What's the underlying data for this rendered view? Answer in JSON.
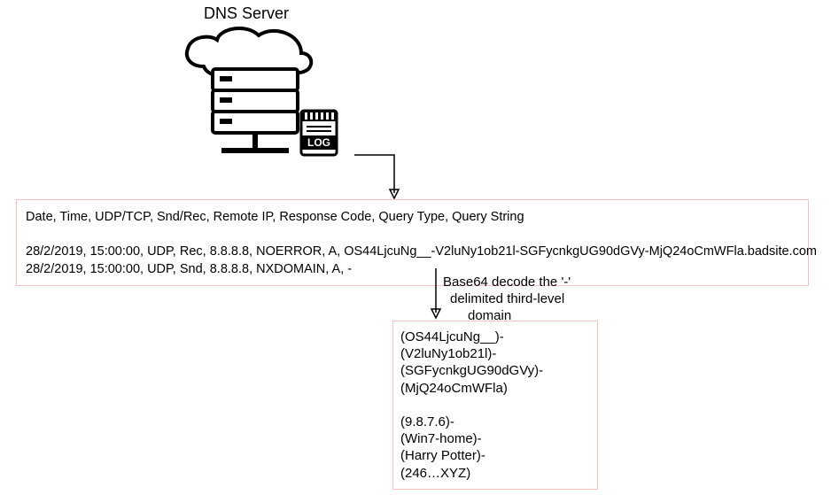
{
  "title": "DNS Server",
  "log": {
    "headers": "Date, Time, UDP/TCP, Snd/Rec, Remote IP, Response Code, Query Type, Query String",
    "rows": [
      "28/2/2019, 15:00:00, UDP, Rec, 8.8.8.8, NOERROR, A, OS44LjcuNg__-V2luNy1ob21l-SGFycnkgUG90dGVy-MjQ24oCmWFla.badsite.com",
      "28/2/2019, 15:00:00, UDP, Snd, 8.8.8.8, NXDOMAIN, A, -"
    ]
  },
  "decode_label_line1": "Base64 decode the '-'",
  "decode_label_line2": "delimited third-level",
  "decode_label_line3": "domain",
  "decoded": {
    "encoded": [
      "(OS44LjcuNg__)-",
      "(V2luNy1ob21l)-",
      "(SGFycnkgUG90dGVy)-",
      "(MjQ24oCmWFla)"
    ],
    "plain": [
      "(9.8.7.6)-",
      "(Win7-home)-",
      "(Harry Potter)-",
      "(246…XYZ)"
    ]
  },
  "icons": {
    "dns_server": "dns-server-icon",
    "log": "log-file-icon"
  }
}
